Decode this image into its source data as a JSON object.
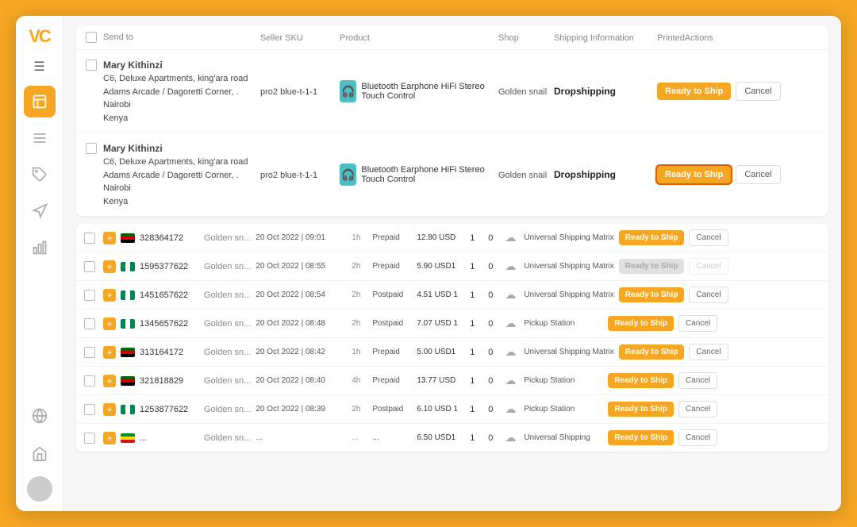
{
  "sidebar": {
    "logo": "VC",
    "hamburger": "☰",
    "icons": [
      {
        "name": "orders-icon",
        "symbol": "📋",
        "active": true
      },
      {
        "name": "list-icon",
        "symbol": "≡",
        "active": false
      },
      {
        "name": "tag-icon",
        "symbol": "🏷",
        "active": false
      },
      {
        "name": "megaphone-icon",
        "symbol": "📢",
        "active": false
      },
      {
        "name": "chart-icon",
        "symbol": "📊",
        "active": false
      },
      {
        "name": "globe-icon",
        "symbol": "🌐",
        "active": false
      },
      {
        "name": "store-icon",
        "symbol": "🏪",
        "active": false
      }
    ]
  },
  "dropship": {
    "headers": {
      "send_to": "Send to",
      "seller_sku": "Seller SKU",
      "product": "Product",
      "shop": "Shop",
      "shipping_info": "Shipping Information",
      "printed_actions": "PrintedActions"
    },
    "rows": [
      {
        "name": "Mary Kithinzi",
        "address1": "C6, Deluxe Apartments, king'ara road",
        "address2": "Adams Arcade / Dagoretti Corner, .",
        "city": "Nairobi",
        "country": "Kenya",
        "sku": "pro2 blue-t-1-1",
        "product_name": "Bluetooth Earphone HiFi Stereo Touch Control",
        "shop": "Golden snail",
        "shipping": "Dropshipping",
        "ready_btn": "Ready to Ship",
        "cancel_btn": "Cancel",
        "highlighted": false
      },
      {
        "name": "Mary Kithinzi",
        "address1": "C6, Deluxe Apartments, king'ara road",
        "address2": "Adams Arcade / Dagoretti Corner, .",
        "city": "Nairobi",
        "country": "Kenya",
        "sku": "pro2 blue-t-1-1",
        "product_name": "Bluetooth Earphone HiFi Stereo Touch Control",
        "shop": "Golden snail",
        "shipping": "Dropshipping",
        "ready_btn": "Ready to Ship",
        "cancel_btn": "Cancel",
        "highlighted": true
      }
    ]
  },
  "orders": {
    "rows": [
      {
        "flag": "ke",
        "order_id": "328364172",
        "shop": "Golden sn...",
        "date": "20 Oct 2022 | 09:01",
        "hours": "1h",
        "payment": "Prepaid",
        "amount": "12.80 USD",
        "qty": "1",
        "zero": "0",
        "shipping_provider": "Universal Shipping Matrix",
        "ready_btn": "Ready to Ship",
        "cancel_btn": "Cancel",
        "ready_disabled": false,
        "cancel_disabled": false
      },
      {
        "flag": "ng",
        "order_id": "1595377622",
        "shop": "Golden sn...",
        "date": "20 Oct 2022 | 08:55",
        "hours": "2h",
        "payment": "Prepaid",
        "amount": "5.90 USD1",
        "qty": "1",
        "zero": "0",
        "shipping_provider": "Universal Shipping Matrix",
        "ready_btn": "Ready to Ship",
        "cancel_btn": "Cancel",
        "ready_disabled": true,
        "cancel_disabled": true
      },
      {
        "flag": "ng",
        "order_id": "1451657622",
        "shop": "Golden sn...",
        "date": "20 Oct 2022 | 08:54",
        "hours": "2h",
        "payment": "Postpaid",
        "amount": "4.51 USD 1",
        "qty": "1",
        "zero": "0",
        "shipping_provider": "Universal Shipping Matrix",
        "ready_btn": "Ready to Ship",
        "cancel_btn": "Cancel",
        "ready_disabled": false,
        "cancel_disabled": false
      },
      {
        "flag": "ng",
        "order_id": "1345657622",
        "shop": "Golden sn...",
        "date": "20 Oct 2022 | 08:48",
        "hours": "2h",
        "payment": "Postpaid",
        "amount": "7.07 USD 1",
        "qty": "1",
        "zero": "0",
        "shipping_provider": "Pickup Station",
        "ready_btn": "Ready to Ship",
        "cancel_btn": "Cancel",
        "ready_disabled": false,
        "cancel_disabled": false
      },
      {
        "flag": "ke",
        "order_id": "313164172",
        "shop": "Golden sn...",
        "date": "20 Oct 2022 | 08:42",
        "hours": "1h",
        "payment": "Prepaid",
        "amount": "5.00 USD1",
        "qty": "1",
        "zero": "0",
        "shipping_provider": "Universal Shipping Matrix",
        "ready_btn": "Ready to Ship",
        "cancel_btn": "Cancel",
        "ready_disabled": false,
        "cancel_disabled": false
      },
      {
        "flag": "ke",
        "order_id": "321818829",
        "shop": "Golden sn...",
        "date": "20 Oct 2022 | 08:40",
        "hours": "4h",
        "payment": "Prepaid",
        "amount": "13.77 USD",
        "qty": "1",
        "zero": "0",
        "shipping_provider": "Pickup Station",
        "ready_btn": "Ready to Ship",
        "cancel_btn": "Cancel",
        "ready_disabled": false,
        "cancel_disabled": false
      },
      {
        "flag": "ng",
        "order_id": "1253877622",
        "shop": "Golden sn...",
        "date": "20 Oct 2022 | 08:39",
        "hours": "2h",
        "payment": "Postpaid",
        "amount": "6.10 USD 1",
        "qty": "1",
        "zero": "0",
        "shipping_provider": "Pickup Station",
        "ready_btn": "Ready to Ship",
        "cancel_btn": "Cancel",
        "ready_disabled": false,
        "cancel_disabled": false
      },
      {
        "flag": "et",
        "order_id": "...",
        "shop": "Golden sn...",
        "date": "...",
        "hours": "...",
        "payment": "...",
        "amount": "6.50 USD1",
        "qty": "1",
        "zero": "0",
        "shipping_provider": "Universal Shipping",
        "ready_btn": "Ready to Ship",
        "cancel_btn": "Cancel",
        "ready_disabled": false,
        "cancel_disabled": false
      }
    ]
  }
}
